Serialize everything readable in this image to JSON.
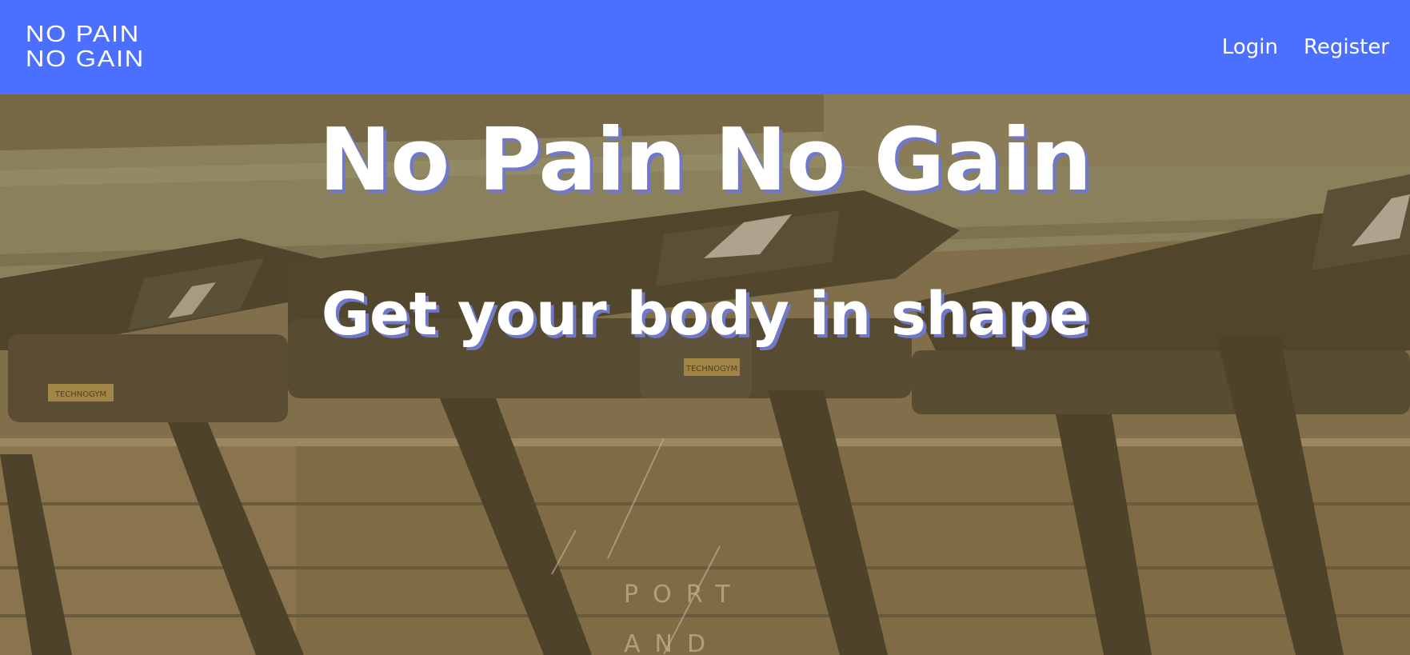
{
  "navbar": {
    "logo_line1": "NO PAIN",
    "logo_line2": "NO GAIN",
    "links": [
      {
        "label": "Login"
      },
      {
        "label": "Register"
      }
    ],
    "bg_color": "#4b70ff"
  },
  "hero": {
    "title": "No Pain No Gain",
    "subtitle": "Get your body in shape",
    "background_image": "gym treadmills photo with sepia overlay",
    "photo_text": {
      "brand1": "TECHNOGYM",
      "brand2": "TECHNOGYM",
      "wall_line1": "PORT",
      "wall_line2": "AND"
    }
  }
}
